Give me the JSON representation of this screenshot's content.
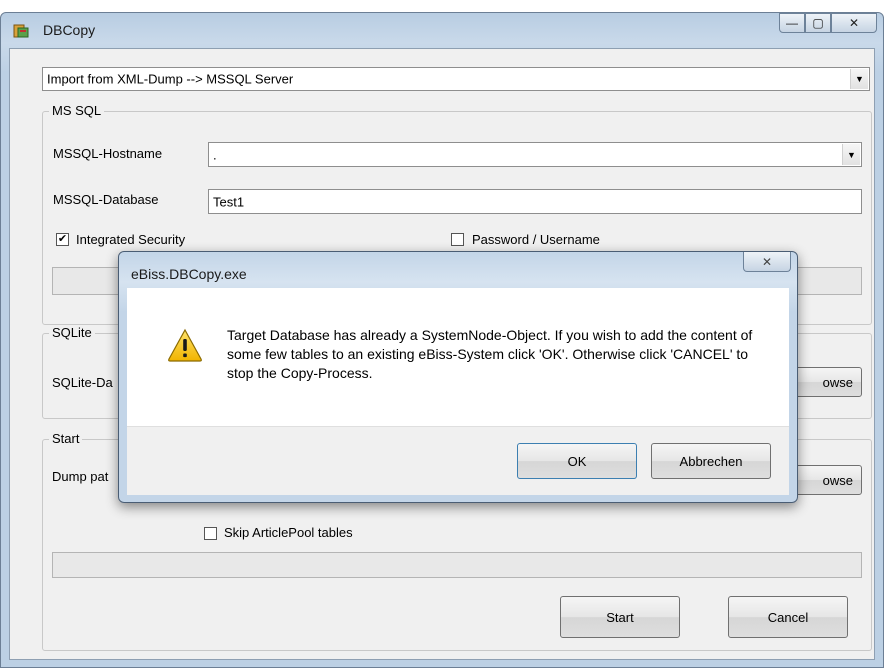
{
  "window": {
    "title": "DBCopy",
    "minimize": "—",
    "maximize": "▢",
    "close": "✕"
  },
  "mode_select": {
    "value": "Import from XML-Dump --> MSSQL Server",
    "arrow": "▼"
  },
  "mssql": {
    "group_label": "MS SQL",
    "hostname_label": "MSSQL-Hostname",
    "hostname_value": ".",
    "database_label": "MSSQL-Database",
    "database_value": "Test1",
    "integrated_security_label": "Integrated Security",
    "integrated_security_checked": true,
    "password_username_label": "Password / Username",
    "password_username_checked": false
  },
  "sqlite": {
    "group_label": "SQLite",
    "db_label": "SQLite-Da",
    "browse_label": "owse"
  },
  "start": {
    "group_label": "Start",
    "dump_label": "Dump pat",
    "browse_label": "owse",
    "skip_label": "Skip ArticlePool tables",
    "start_button": "Start",
    "cancel_button": "Cancel"
  },
  "dialog": {
    "title": "eBiss.DBCopy.exe",
    "close": "✕",
    "message": "Target Database has already a SystemNode-Object. If you wish to add the content of some few tables to an existing eBiss-System click 'OK'. Otherwise click 'CANCEL' to stop the Copy-Process.",
    "ok_button": "OK",
    "cancel_button": "Abbrechen"
  },
  "icons": {
    "app": "database-copy-icon",
    "warning": "warning-triangle-icon"
  }
}
